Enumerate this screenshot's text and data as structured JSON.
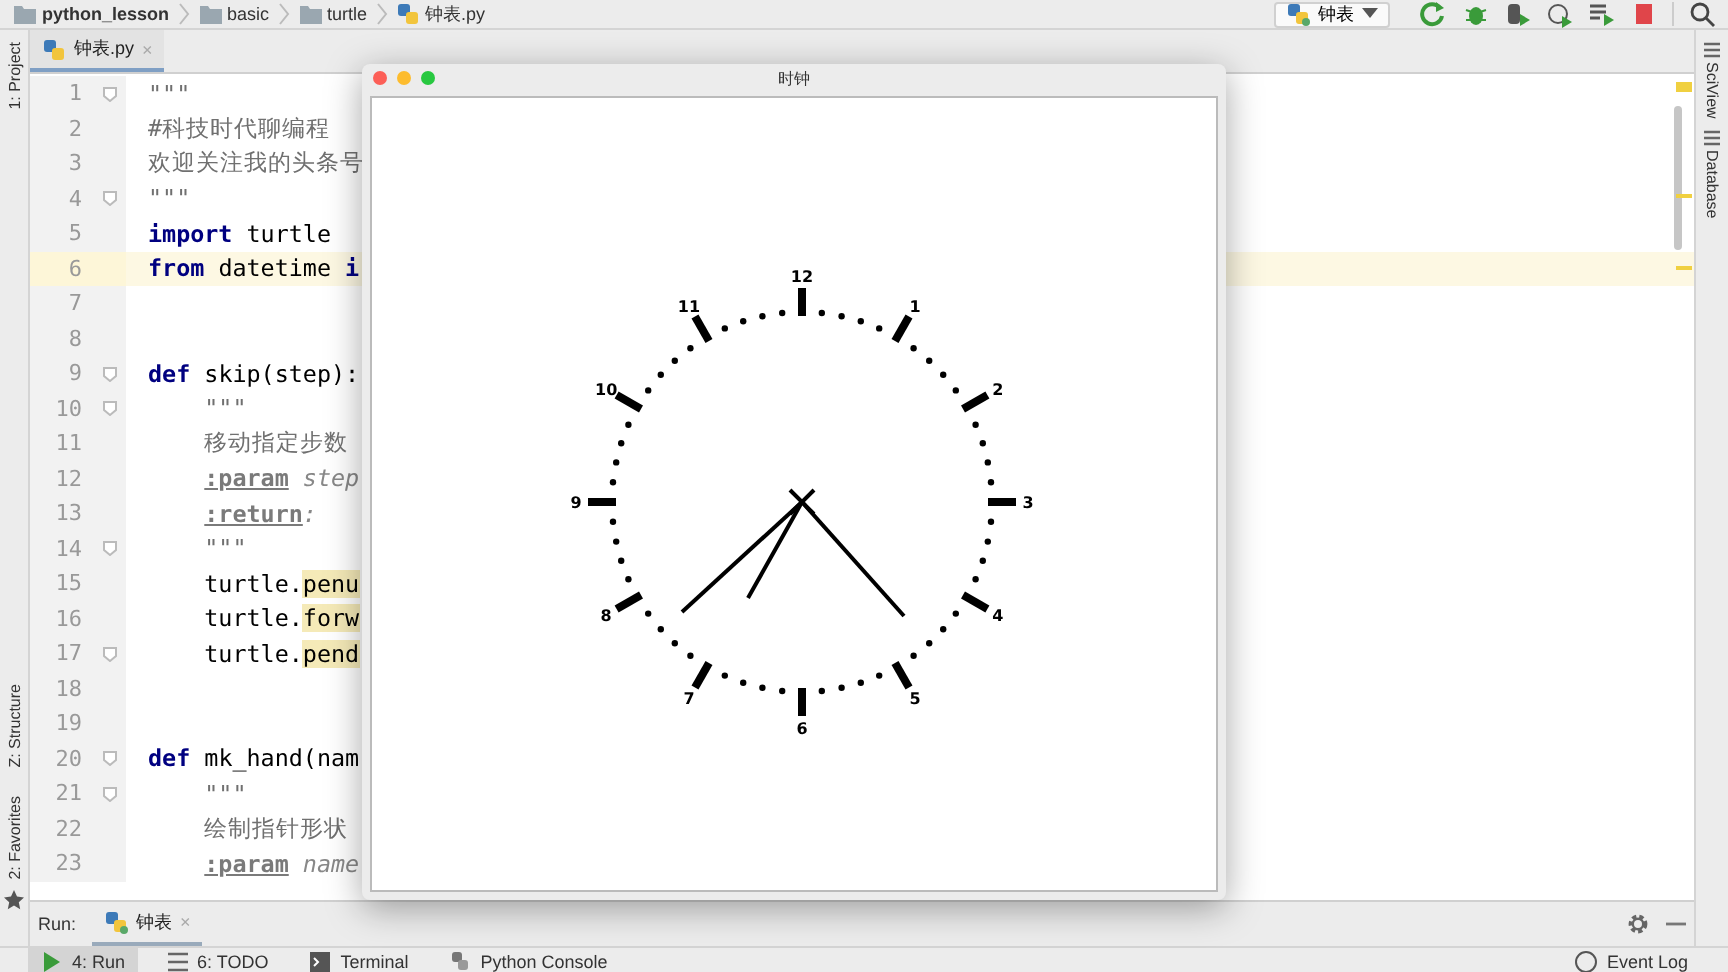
{
  "breadcrumbs": [
    {
      "label": "python_lesson",
      "kind": "project"
    },
    {
      "label": "basic",
      "kind": "folder"
    },
    {
      "label": "turtle",
      "kind": "folder"
    },
    {
      "label": "钟表.py",
      "kind": "file"
    }
  ],
  "run_config": {
    "label": "钟表"
  },
  "editor_tabs": [
    {
      "label": "钟表.py",
      "close": "×",
      "selected": true
    }
  ],
  "left_tools": [
    {
      "label": "1: Project",
      "kind": "top"
    },
    {
      "label": "Z: Structure",
      "kind": "bottom"
    },
    {
      "label": "2: Favorites",
      "kind": "bottom"
    }
  ],
  "right_tools": [
    "SciView",
    "Database"
  ],
  "code": [
    {
      "number": "1",
      "current": false,
      "fold": true,
      "indented": false,
      "tokens": [
        {
          "kind": "doc",
          "text": "\"\"\""
        }
      ]
    },
    {
      "number": "2",
      "current": false,
      "fold": false,
      "indented": false,
      "tokens": [
        {
          "kind": "doc",
          "text": "#科技时代聊编程"
        }
      ]
    },
    {
      "number": "3",
      "current": false,
      "fold": false,
      "indented": false,
      "tokens": [
        {
          "kind": "doc",
          "text": "欢迎关注我的头条号"
        }
      ]
    },
    {
      "number": "4",
      "current": false,
      "fold": true,
      "indented": false,
      "tokens": [
        {
          "kind": "doc",
          "text": "\"\"\""
        }
      ]
    },
    {
      "number": "5",
      "current": false,
      "fold": false,
      "indented": false,
      "tokens": [
        {
          "kind": "kw",
          "text": "import"
        },
        {
          "kind": "plain",
          "text": " turtle"
        }
      ]
    },
    {
      "number": "6",
      "current": true,
      "fold": false,
      "indented": false,
      "tokens": [
        {
          "kind": "kw",
          "text": "from"
        },
        {
          "kind": "plain",
          "text": " datetime "
        },
        {
          "kind": "kw",
          "text": "i"
        }
      ]
    },
    {
      "number": "7",
      "current": false,
      "fold": false
    },
    {
      "number": "8",
      "current": false,
      "fold": false
    },
    {
      "number": "9",
      "current": false,
      "fold": true,
      "indented": false,
      "tokens": [
        {
          "kind": "kw",
          "text": "def"
        },
        {
          "kind": "plain",
          "text": " skip(step):"
        }
      ]
    },
    {
      "number": "10",
      "current": false,
      "fold": true,
      "indented": true,
      "tokens": [
        {
          "kind": "doc",
          "text": "\"\"\""
        }
      ]
    },
    {
      "number": "11",
      "current": false,
      "fold": false,
      "indented": true,
      "tokens": [
        {
          "kind": "doc",
          "text": "移动指定步数"
        }
      ]
    },
    {
      "number": "12",
      "current": false,
      "fold": false,
      "indented": true,
      "tokens": [
        {
          "kind": "tag",
          "text": ":param"
        },
        {
          "kind": "ital",
          "text": " step"
        }
      ]
    },
    {
      "number": "13",
      "current": false,
      "fold": false,
      "indented": true,
      "tokens": [
        {
          "kind": "tag",
          "text": ":return"
        },
        {
          "kind": "ital",
          "text": ":"
        }
      ]
    },
    {
      "number": "14",
      "current": false,
      "fold": true,
      "indented": true,
      "tokens": [
        {
          "kind": "doc",
          "text": "\"\"\""
        }
      ]
    },
    {
      "number": "15",
      "current": false,
      "fold": false,
      "indented": true,
      "tokens": [
        {
          "kind": "plain",
          "text": "turtle."
        },
        {
          "kind": "hl",
          "text": "penu"
        }
      ]
    },
    {
      "number": "16",
      "current": false,
      "fold": false,
      "indented": true,
      "tokens": [
        {
          "kind": "plain",
          "text": "turtle."
        },
        {
          "kind": "hl",
          "text": "forw"
        }
      ]
    },
    {
      "number": "17",
      "current": false,
      "fold": true,
      "indented": true,
      "tokens": [
        {
          "kind": "plain",
          "text": "turtle."
        },
        {
          "kind": "hl",
          "text": "pend"
        }
      ]
    },
    {
      "number": "18",
      "current": false,
      "fold": false
    },
    {
      "number": "19",
      "current": false,
      "fold": false
    },
    {
      "number": "20",
      "current": false,
      "fold": true,
      "indented": false,
      "tokens": [
        {
          "kind": "kw",
          "text": "def"
        },
        {
          "kind": "plain",
          "text": " mk_hand(nam"
        }
      ]
    },
    {
      "number": "21",
      "current": false,
      "fold": true,
      "indented": true,
      "tokens": [
        {
          "kind": "doc",
          "text": "\"\"\""
        }
      ]
    },
    {
      "number": "22",
      "current": false,
      "fold": false,
      "indented": true,
      "tokens": [
        {
          "kind": "doc",
          "text": "绘制指针形状"
        }
      ]
    },
    {
      "number": "23",
      "current": false,
      "fold": false,
      "indented": true,
      "tokens": [
        {
          "kind": "tag",
          "text": ":param"
        },
        {
          "kind": "ital",
          "text": " name"
        }
      ]
    }
  ],
  "clock_window": {
    "title": "时钟",
    "numerals": [
      "12",
      "1",
      "2",
      "3",
      "4",
      "5",
      "6",
      "7",
      "8",
      "9",
      "10",
      "11"
    ]
  },
  "run_panel": {
    "label": "Run:",
    "tabs": [
      {
        "label": "钟表",
        "close": "×",
        "selected": true
      }
    ]
  },
  "bottom_tools": [
    {
      "label": "4: Run",
      "kind": "run",
      "selected": true
    },
    {
      "label": "6: TODO",
      "kind": "todo",
      "selected": false
    },
    {
      "label": "Terminal",
      "kind": "terminal",
      "selected": false
    },
    {
      "label": "Python Console",
      "kind": "console",
      "selected": false
    }
  ],
  "event_log": {
    "label": "Event Log"
  }
}
